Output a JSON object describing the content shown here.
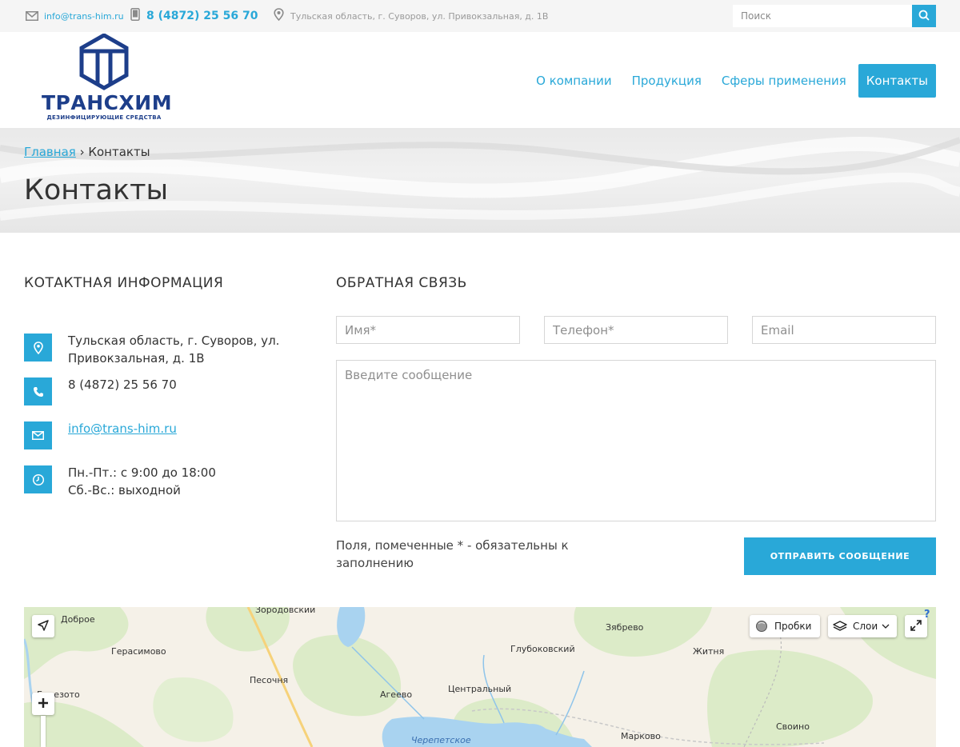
{
  "topbar": {
    "email": "info@trans-him.ru",
    "phone": "8 (4872) 25 56 70",
    "address": "Тульская область, г. Суворов, ул. Привокзальная, д. 1В",
    "search_placeholder": "Поиск"
  },
  "logo": {
    "name": "ТРАНСХИМ",
    "tagline": "ДЕЗИНФИЦИРУЮЩИЕ СРЕДСТВА",
    "color": "#1d3e8a"
  },
  "nav": {
    "items": [
      {
        "label": "О компании"
      },
      {
        "label": "Продукция"
      },
      {
        "label": "Сферы применения"
      },
      {
        "label": "Контакты",
        "active": true
      }
    ]
  },
  "breadcrumb": {
    "home": "Главная",
    "separator": "›",
    "current": "Контакты"
  },
  "page": {
    "title": "Контакты"
  },
  "contact_info": {
    "title": "КОТАКТНАЯ ИНФОРМАЦИЯ",
    "address_line1": "Тульская область, г. Суворов, ул.",
    "address_line2": "Привокзальная, д. 1В",
    "phone": "8 (4872) 25 56 70",
    "email": "info@trans-him.ru",
    "hours_line1": "Пн.-Пт.: с 9:00 до 18:00",
    "hours_line2": "Сб.-Вс.: выходной"
  },
  "feedback": {
    "title": "ОБРАТНАЯ СВЯЗЬ",
    "name_placeholder": "Имя*",
    "phone_placeholder": "Телефон*",
    "email_placeholder": "Email",
    "message_placeholder": "Введите сообщение",
    "required_note": "Поля, помеченные * - обязательны к заполнению",
    "submit_label": "ОТПРАВИТЬ СООБЩЕНИЕ"
  },
  "map": {
    "traffic_label": "Пробки",
    "layers_label": "Слои",
    "help_label": "?",
    "places": [
      {
        "name": "Доброе"
      },
      {
        "name": "Зородовский"
      },
      {
        "name": "Зябрево"
      },
      {
        "name": "Герасимово"
      },
      {
        "name": "Глубоковский"
      },
      {
        "name": "Житня"
      },
      {
        "name": "Песочня"
      },
      {
        "name": "Центральный"
      },
      {
        "name": "Агеево"
      },
      {
        "name": "Березото"
      },
      {
        "name": "Марково"
      },
      {
        "name": "Своино"
      },
      {
        "name": "Черепетское"
      }
    ]
  },
  "colors": {
    "accent": "#29a8d8",
    "text": "#333333",
    "topbar_bg": "#f5f5f5"
  }
}
